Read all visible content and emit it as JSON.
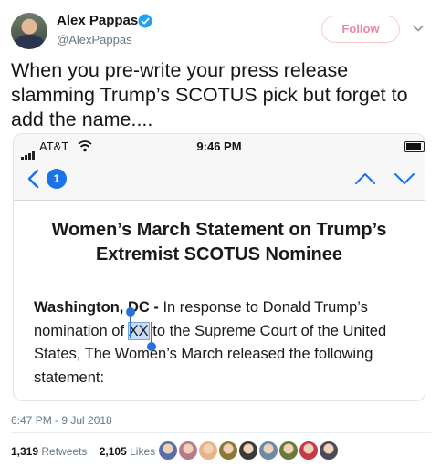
{
  "author": {
    "name": "Alex Pappas",
    "handle": "@AlexPappas",
    "verified": true,
    "follow_label": "Follow",
    "caret_icon": "chevron-down-icon"
  },
  "tweet": {
    "text": "When you pre-write your press release slamming Trump’s SCOTUS pick but forget to add the name....",
    "timestamp": "6:47 PM - 9 Jul 2018",
    "retweets_count": "1,319",
    "retweets_label": "Retweets",
    "likes_count": "2,105",
    "likes_label": "Likes",
    "liker_colors": [
      "#5a6fa8",
      "#b57a8c",
      "#e6b48a",
      "#8a7a3a",
      "#3a3a3a",
      "#6b8aa8",
      "#6b7a3a",
      "#c43a4a",
      "#4a4a5a"
    ]
  },
  "screenshot": {
    "status": {
      "carrier": "AT&T",
      "time": "9:46 PM"
    },
    "nav": {
      "unread_count": "1"
    },
    "headline_line1": "Women’s March Statement on Trump’s",
    "headline_line2": "Extremist SCOTUS Nominee",
    "body": {
      "location": "Washington, DC -",
      "l1_rest": " In response to Donald Trump’s",
      "l2_pre": "nomination of ",
      "placeholder": "XX",
      "l2_post": " to the Supreme Court of the United",
      "l3": "States, The Women’s March released the following",
      "l4": "statement:"
    },
    "colors": {
      "ios_blue": "#1a73e8",
      "selection": "#c9dcf5"
    }
  }
}
